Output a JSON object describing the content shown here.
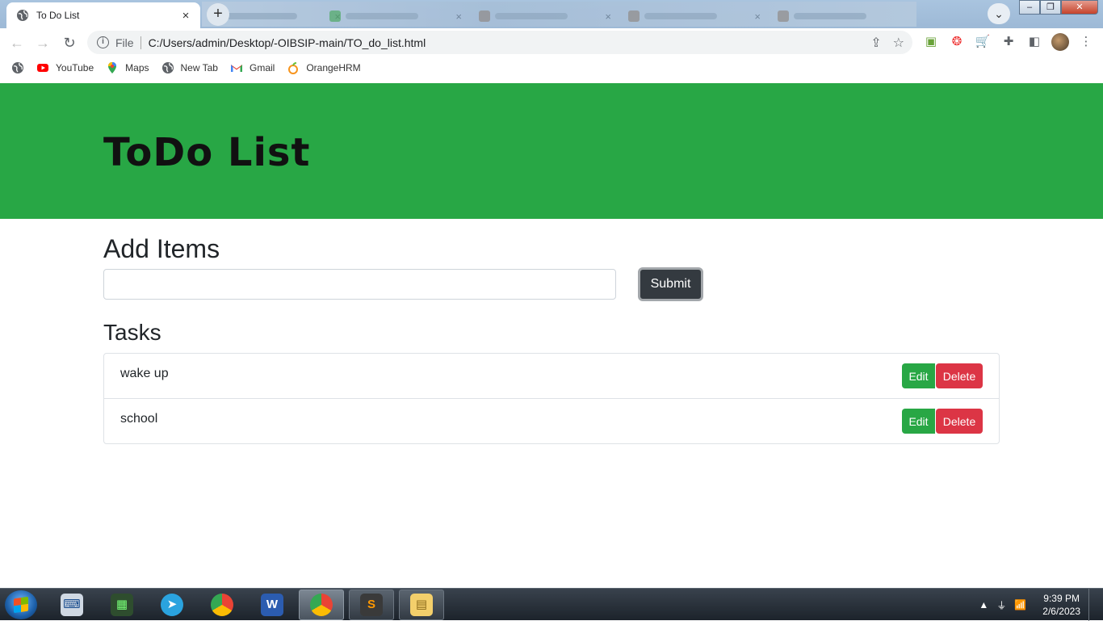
{
  "browser": {
    "tab_title": "To Do List",
    "tab_close": "×",
    "new_tab": "+",
    "url_scheme": "File",
    "url": "C:/Users/admin/Desktop/-OIBSIP-main/TO_do_list.html",
    "win_minimize": "–",
    "win_restore": "❐",
    "win_close": "✕"
  },
  "bookmarks": [
    {
      "label": "",
      "icon": "globe-icon"
    },
    {
      "label": "YouTube",
      "icon": "youtube-icon"
    },
    {
      "label": "Maps",
      "icon": "maps-icon"
    },
    {
      "label": "New Tab",
      "icon": "globe-icon"
    },
    {
      "label": "Gmail",
      "icon": "gmail-icon"
    },
    {
      "label": "OrangeHRM",
      "icon": "orangehrm-icon"
    }
  ],
  "page": {
    "title": "ToDo List",
    "add_heading": "Add Items",
    "input_value": "",
    "submit_label": "Submit",
    "tasks_heading": "Tasks",
    "tasks": [
      {
        "text": "wake up",
        "edit_label": "Edit",
        "delete_label": "Delete"
      },
      {
        "text": "school",
        "edit_label": "Edit",
        "delete_label": "Delete"
      }
    ]
  },
  "taskbar": {
    "time": "9:39 PM",
    "date": "2/6/2023"
  },
  "colors": {
    "hero": "#28a745",
    "submit": "#343a40",
    "edit": "#28a745",
    "delete": "#dc3545"
  }
}
